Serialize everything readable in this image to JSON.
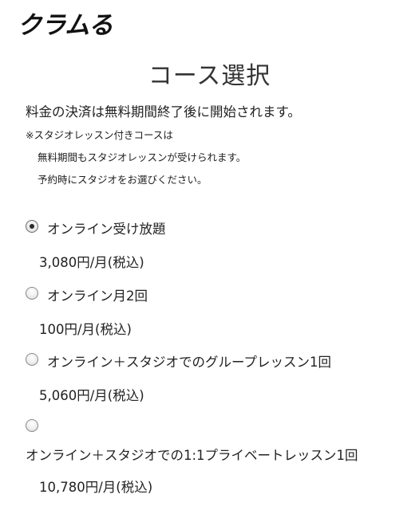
{
  "header": {
    "logo_text": "クラムる"
  },
  "main": {
    "title": "コース選択",
    "lead": "料金の決済は無料期間終了後に開始されます。",
    "notes": [
      "※スタジオレッスン付きコースは",
      "無料期間もスタジオレッスンが受けられます。",
      "予約時にスタジオをお選びください。"
    ],
    "plans": [
      {
        "label": "オンライン受け放題",
        "price": "3,080円/月(税込)",
        "selected": true
      },
      {
        "label": "オンライン月2回",
        "price": "100円/月(税込)",
        "selected": false
      },
      {
        "label": "オンライン＋スタジオでのグループレッスン1回",
        "price": "5,060円/月(税込)",
        "selected": false
      },
      {
        "label": "オンライン＋スタジオでの1:1プライベートレッスン1回",
        "price": "10,780円/月(税込)",
        "selected": false
      }
    ]
  }
}
